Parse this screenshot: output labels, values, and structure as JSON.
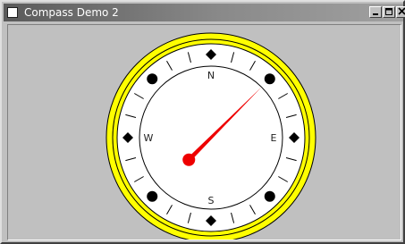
{
  "window": {
    "title": "Compass Demo 2",
    "controls": {
      "minimize_icon": "minimize-icon",
      "maximize_icon": "maximize-icon",
      "close_icon": "close-icon"
    }
  },
  "compass": {
    "heading_deg": 45,
    "labels": {
      "north": "N",
      "east": "E",
      "south": "S",
      "west": "W"
    },
    "colors": {
      "bezel": "#ffff00",
      "face": "#ffffff",
      "needle": "#ee0000",
      "marker": "#000000",
      "background": "#c0c0c0"
    }
  }
}
